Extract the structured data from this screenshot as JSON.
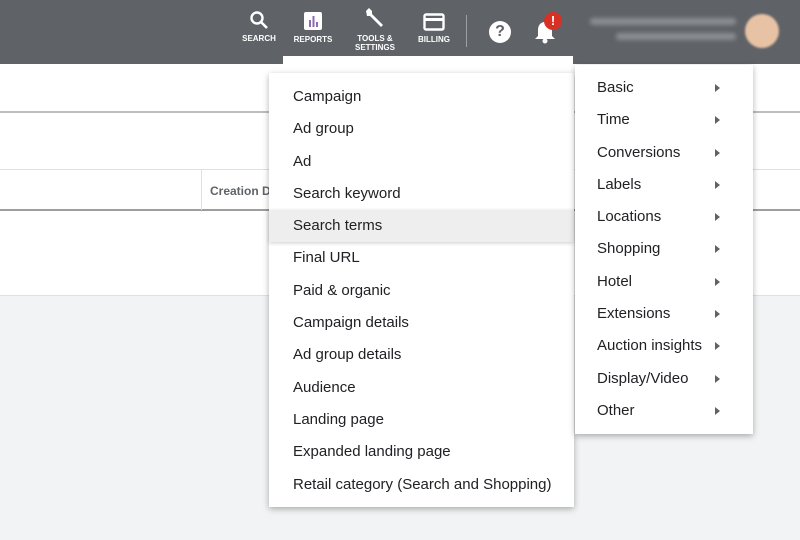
{
  "header": {
    "nav": [
      {
        "label": "SEARCH"
      },
      {
        "label": "REPORTS"
      },
      {
        "label": "TOOLS &",
        "label2": "SETTINGS"
      },
      {
        "label": "BILLING"
      }
    ],
    "alert_badge": "!"
  },
  "table": {
    "column_header": "Creation Da"
  },
  "report_menu": {
    "items": [
      "Campaign",
      "Ad group",
      "Ad",
      "Search keyword",
      "Search terms",
      "Final URL",
      "Paid & organic",
      "Campaign details",
      "Ad group details",
      "Audience",
      "Landing page",
      "Expanded landing page",
      "Retail category (Search and Shopping)"
    ],
    "highlighted": "Search terms"
  },
  "category_menu": {
    "items": [
      "Basic",
      "Time",
      "Conversions",
      "Labels",
      "Locations",
      "Shopping",
      "Hotel",
      "Extensions",
      "Auction insights",
      "Display/Video",
      "Other"
    ]
  },
  "colors": {
    "topbar": "#5f6368",
    "badge": "#d93025"
  }
}
